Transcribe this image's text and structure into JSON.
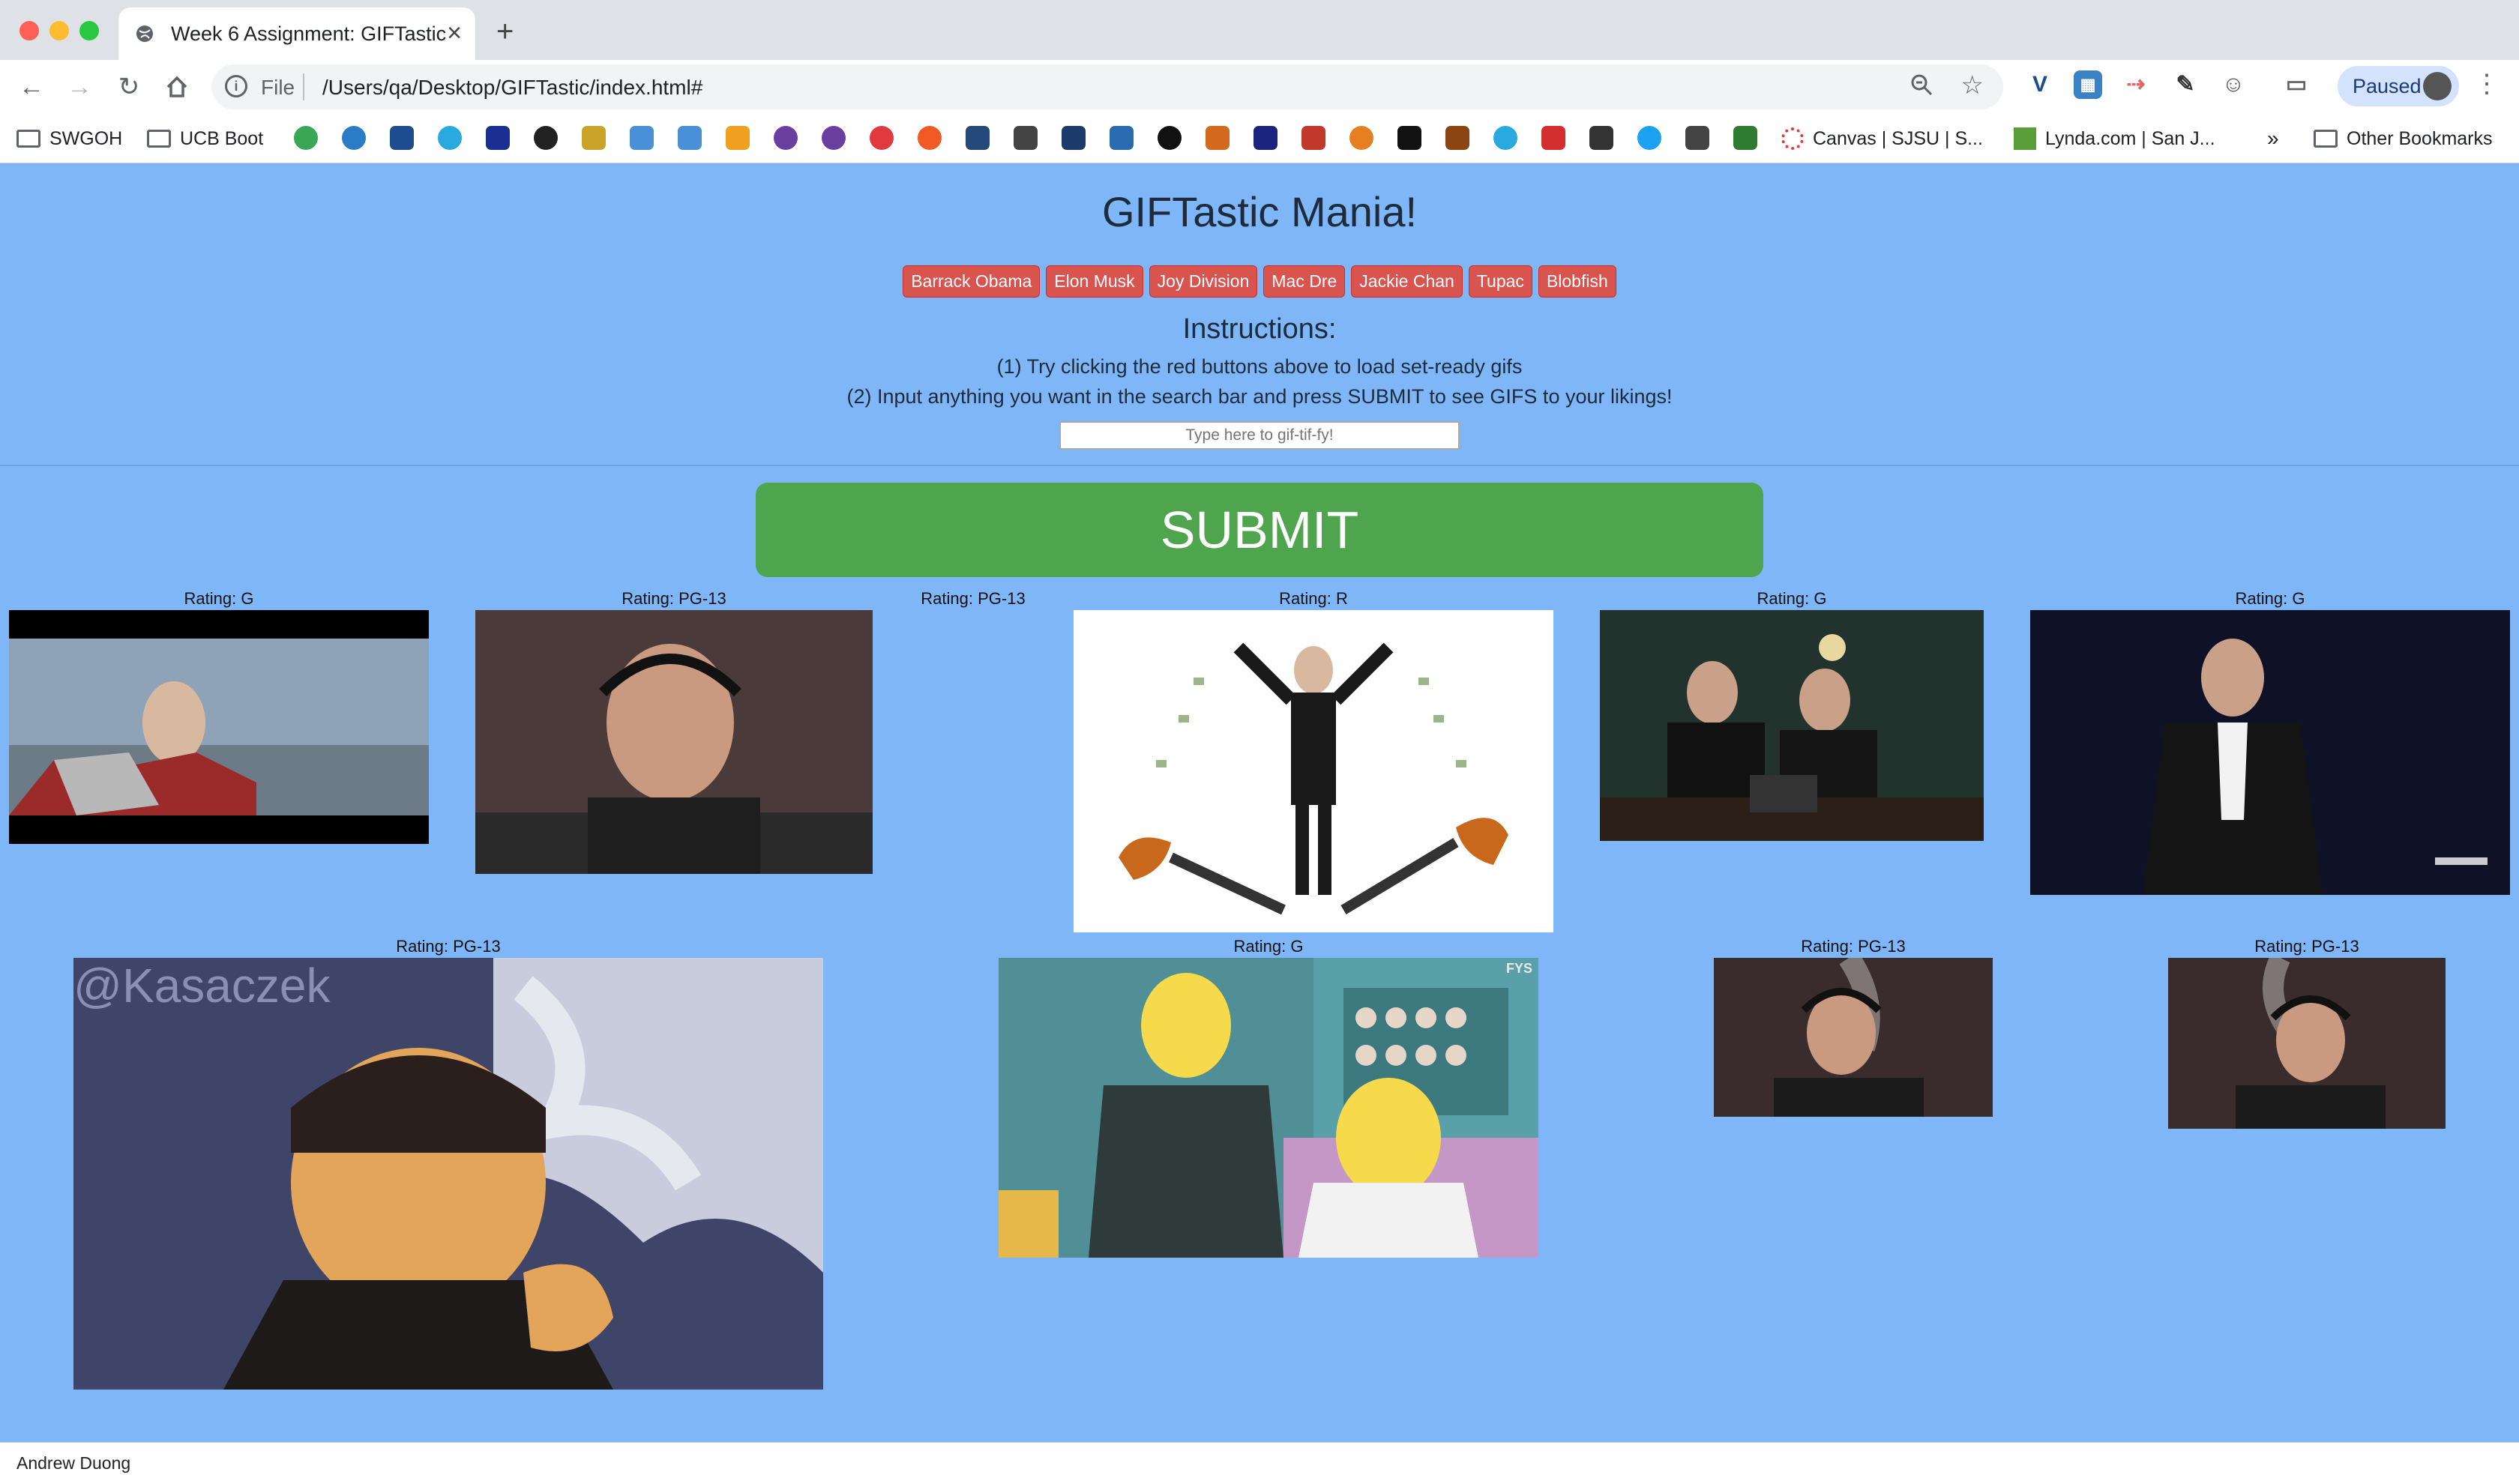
{
  "browser": {
    "tab_title": "Week 6 Assignment: GIFTastic",
    "url_prefix": "File",
    "url": "/Users/qa/Desktop/GIFTastic/index.html#",
    "profile_label": "Paused",
    "bookmarks": [
      "SWGOH",
      "UCB Boot",
      "Canvas | SJSU | S...",
      "Lynda.com | San J...",
      "Other Bookmarks"
    ],
    "bookmarks_overflow": "»"
  },
  "page": {
    "title": "GIFTastic Mania!",
    "topic_buttons": [
      "Barrack Obama",
      "Elon Musk",
      "Joy Division",
      "Mac Dre",
      "Jackie Chan",
      "Tupac",
      "Blobfish"
    ],
    "instructions_title": "Instructions:",
    "instruction_1": "(1) Try clicking the red buttons above to load set-ready gifs",
    "instruction_2": "(2) Input anything you want in the search bar and press SUBMIT to see GIFS to your likings!",
    "search_placeholder": "Type here to gif-tif-fy!",
    "submit_label": "SUBMIT",
    "gifs": [
      {
        "rating": "Rating: G",
        "desc": "Elon Musk in Iron Man suit"
      },
      {
        "rating": "Rating: PG-13",
        "desc": "Elon Musk smoking on podcast"
      },
      {
        "rating": "Rating: PG-13",
        "desc": "missing image"
      },
      {
        "rating": "Rating: R",
        "desc": "Elon Musk with flamethrowers and money"
      },
      {
        "rating": "Rating: G",
        "desc": "Elon Musk with man at laptop"
      },
      {
        "rating": "Rating: G",
        "desc": "Elon Musk dancing on stage"
      },
      {
        "rating": "Rating: PG-13",
        "desc": "Pixel art Elon smoking",
        "watermark": "@Kasaczek"
      },
      {
        "rating": "Rating: G",
        "desc": "Simpsons cartoon Elon with Homer",
        "badge": "FYS"
      },
      {
        "rating": "Rating: PG-13",
        "desc": "Elon Musk smoking podcast"
      },
      {
        "rating": "Rating: PG-13",
        "desc": "Elon Musk smoking podcast"
      }
    ]
  },
  "status_bar": {
    "text": "Andrew Duong"
  }
}
